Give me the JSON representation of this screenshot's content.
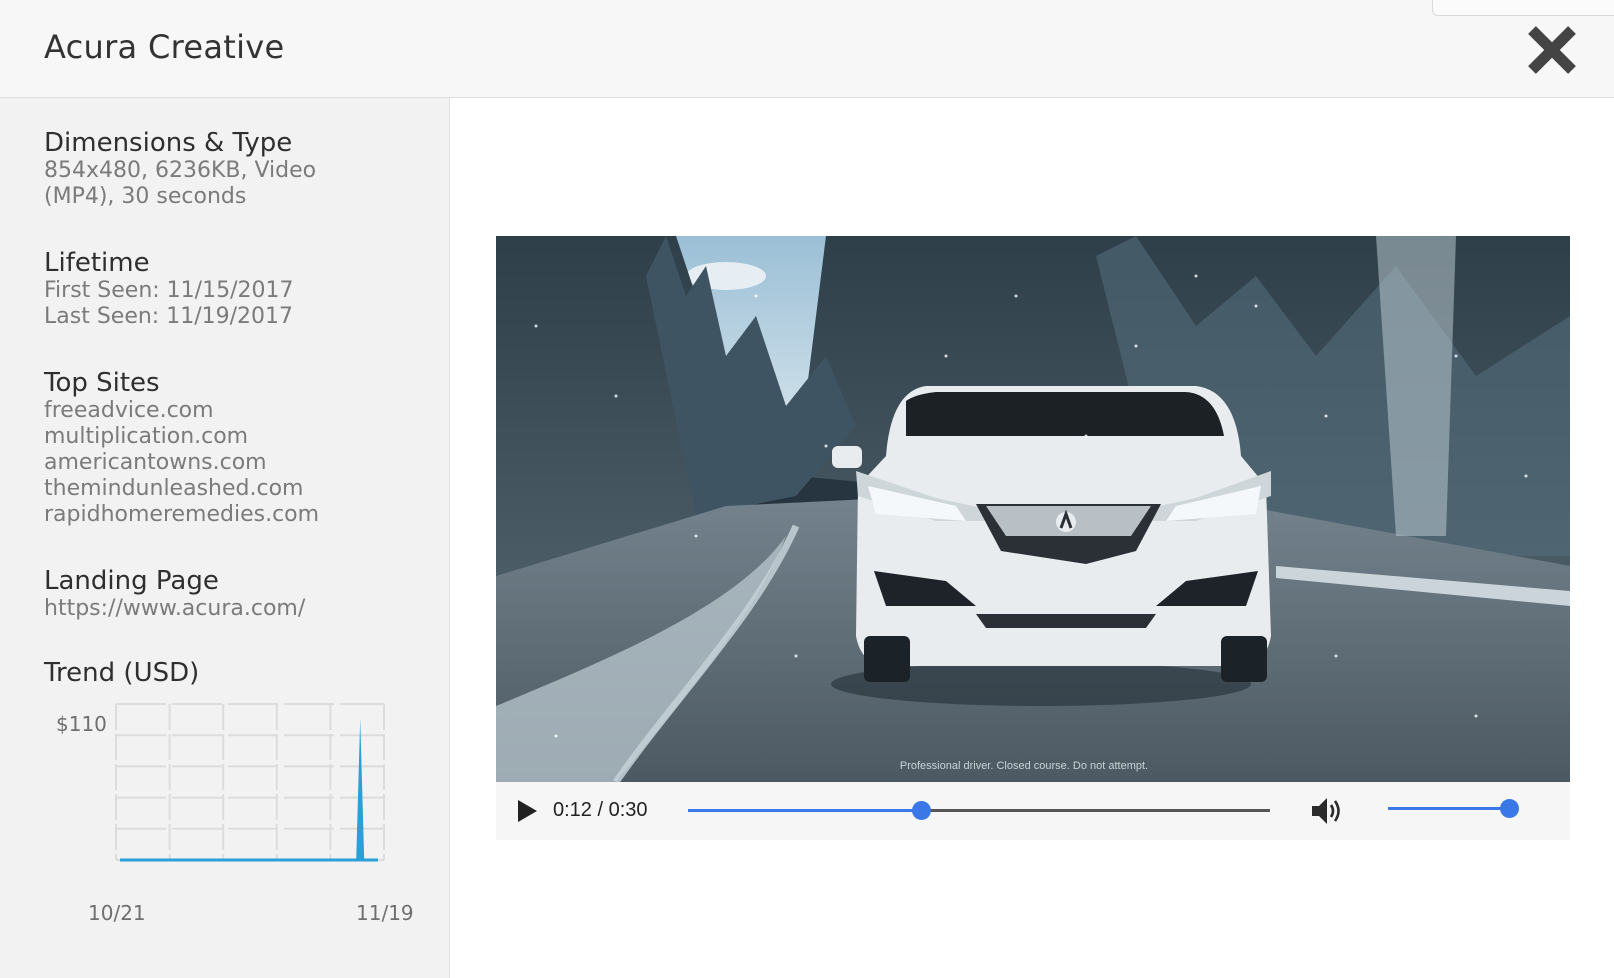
{
  "header": {
    "title": "Acura Creative"
  },
  "sidebar": {
    "dimensions": {
      "heading": "Dimensions & Type",
      "lines": [
        "854x480, 6236KB, Video",
        "(MP4), 30 seconds"
      ]
    },
    "lifetime": {
      "heading": "Lifetime",
      "first_seen": "First Seen: 11/15/2017",
      "last_seen": "Last Seen: 11/19/2017"
    },
    "top_sites": {
      "heading": "Top Sites",
      "sites": [
        "freeadvice.com",
        "multiplication.com",
        "americantowns.com",
        "themindunleashed.com",
        "rapidhomeremedies.com"
      ]
    },
    "landing_page": {
      "heading": "Landing Page",
      "url": "https://www.acura.com/"
    },
    "trend": {
      "heading": "Trend (USD)"
    }
  },
  "chart_data": {
    "type": "area",
    "title": "Trend (USD)",
    "y_tick_label": "$110",
    "x_tick_labels": [
      "10/21",
      "11/19"
    ],
    "ylim": [
      0,
      110
    ],
    "x": [
      "10/21",
      "10/22",
      "10/23",
      "10/24",
      "10/25",
      "10/26",
      "10/27",
      "10/28",
      "10/29",
      "10/30",
      "10/31",
      "11/01",
      "11/02",
      "11/03",
      "11/04",
      "11/05",
      "11/06",
      "11/07",
      "11/08",
      "11/09",
      "11/10",
      "11/11",
      "11/12",
      "11/13",
      "11/14",
      "11/15",
      "11/16",
      "11/17",
      "11/18",
      "11/19"
    ],
    "values": [
      0,
      0,
      0,
      0,
      0,
      0,
      0,
      0,
      0,
      0,
      0,
      0,
      0,
      0,
      0,
      0,
      0,
      0,
      0,
      0,
      0,
      0,
      0,
      0,
      0,
      0,
      0,
      105,
      0,
      0
    ],
    "grid": true,
    "color": "#2a9fd8"
  },
  "player": {
    "caption": "Professional driver. Closed course. Do not attempt.",
    "current_time": "0:12",
    "duration": "0:30",
    "time_separator": " / ",
    "progress": 0.4,
    "volume": 1.0,
    "accent_color": "#3b78e7",
    "icons": {
      "play": "play-icon",
      "volume": "volume-icon",
      "close": "close-icon"
    }
  }
}
